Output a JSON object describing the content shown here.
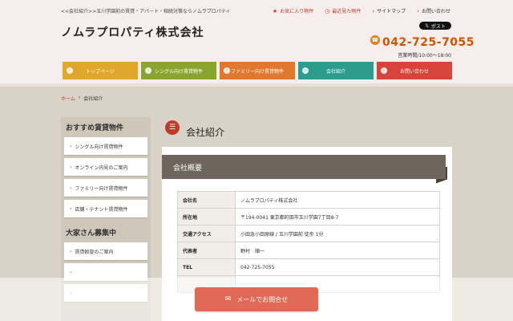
{
  "header": {
    "tagline": "<<会社紹介>>玉川学園前の賃貸・アパート・相続対策ならノムラプロパティ",
    "title": "ノムラプロパティ株式会社",
    "links": [
      {
        "icon": "★",
        "label": "お気に入り物件"
      },
      {
        "icon": "◷",
        "label": "最近見た物件"
      },
      {
        "icon": "›",
        "label": "サイトマップ"
      },
      {
        "icon": "›",
        "label": "お問い合わせ"
      }
    ],
    "post_label": "ポスト",
    "phone": "042-725-7055",
    "hours": "営業時間/10:00～18:00"
  },
  "nav": [
    {
      "label": "トップページ",
      "color": "#e0a72a"
    },
    {
      "label": "シングル向け賃貸物件",
      "color": "#8aa52e"
    },
    {
      "label": "ファミリー向け賃貸物件",
      "color": "#e2782d"
    },
    {
      "label": "会社紹介",
      "color": "#2a9d8f"
    },
    {
      "label": "お問い合わせ",
      "color": "#d9443a"
    }
  ],
  "breadcrumb": {
    "home": "ホーム",
    "separator": "›",
    "current": "会社紹介"
  },
  "sidebar": {
    "heading1": "おすすめ賃貸物件",
    "items1": [
      "シングル向け賃貸物件",
      "オンライン内見のご案内",
      "ファミリー向け賃貸物件",
      "店舗・テナント賃貸物件"
    ],
    "heading2": "大家さん募集中",
    "items2": [
      "賃貸斡旋のご案内",
      "",
      ""
    ]
  },
  "main": {
    "heading": "会社紹介",
    "section_title": "会社概要",
    "rows": [
      {
        "key": "会社名",
        "value": "ノムラプロパティ株式会社"
      },
      {
        "key": "所在地",
        "value": "〒194-0041 東京都町田市玉川学園7丁目8-7"
      },
      {
        "key": "交通アクセス",
        "value": "小田急小田原線 / 玉川学園前 徒歩 1分"
      },
      {
        "key": "代表者",
        "value": "野村　順一"
      },
      {
        "key": "TEL",
        "value": "042-725-7055"
      },
      {
        "key": "",
        "value": ""
      }
    ]
  },
  "mail_button": {
    "label": "メールでお問合せ"
  }
}
